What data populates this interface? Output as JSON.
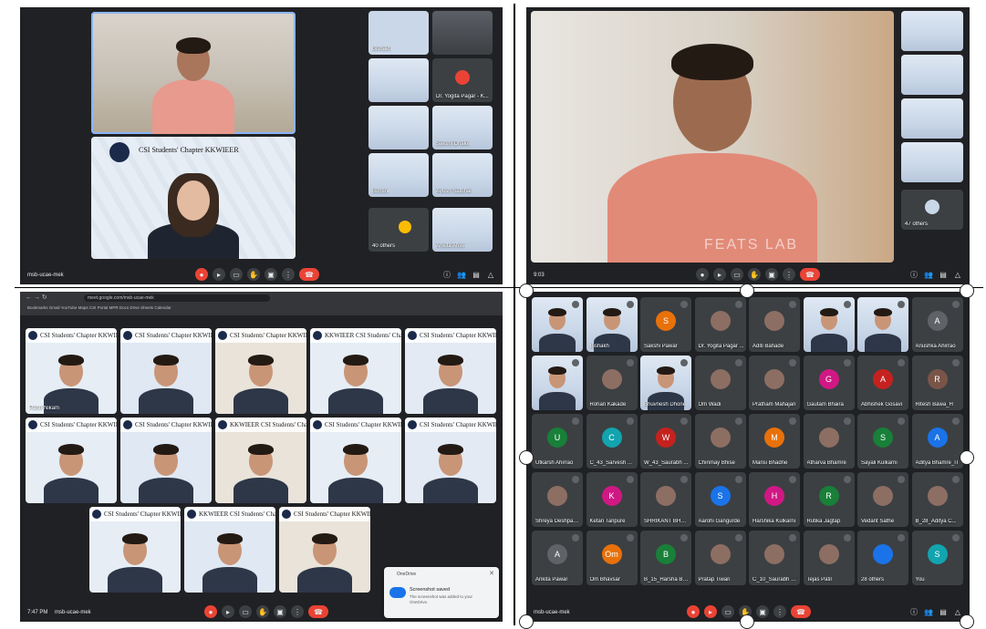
{
  "meeting_label": "meet.google.com",
  "meet_label_short": "msb-ucae-mek",
  "chapter_banner": "CSI Students' Chapter KKWIEER",
  "chapter_banner_alt": "KKWIEER CSI Students' Chapter",
  "times": {
    "p3": "7:47 PM",
    "p2": "9:03"
  },
  "panel1": {
    "others_label": "40 others",
    "side_names": [
      "Bishakh",
      "",
      "Dr. Yogita Pagar - K...",
      "",
      "Sakshi Dhake",
      "",
      "Buhsni",
      "Ayush Satbhai",
      "",
      "Ankita Ahire"
    ]
  },
  "panel2": {
    "others_label": "47 others",
    "presenter_watermark": "FEATS LAB"
  },
  "panel3": {
    "url": "meet.google.com/msb-ucae-mek",
    "bookmarks": "Bookmarks   Gmail   YouTube   Maps   CSI Portal   MPR   Docs   Drive   Sheets   Calendar",
    "row_names": [
      "Parth Nikam",
      "",
      "",
      "",
      "",
      "",
      "",
      "",
      "",
      "",
      "",
      "",
      ""
    ],
    "toast": {
      "app": "OneDrive",
      "title": "Screenshot saved",
      "body": "The screenshot was added to your OneDrive."
    }
  },
  "panel4": {
    "tiles": [
      {
        "name": "",
        "initial": "",
        "color": "",
        "video": true
      },
      {
        "name": "Bishakh",
        "initial": "",
        "color": "",
        "video": true
      },
      {
        "name": "Sakshi Pawar",
        "initial": "S",
        "color": "#e8710a"
      },
      {
        "name": "Dr. Yogita Pagar ...",
        "initial": "",
        "color": "",
        "photo": true
      },
      {
        "name": "Aditi Bahade",
        "initial": "",
        "color": "",
        "photo": true
      },
      {
        "name": "",
        "initial": "",
        "color": "",
        "video": true
      },
      {
        "name": "",
        "initial": "",
        "color": "",
        "video": true
      },
      {
        "name": "Anushka Ahirrao",
        "initial": "A",
        "color": "#5f6368"
      },
      {
        "name": "",
        "initial": "",
        "color": "",
        "video": true
      },
      {
        "name": "Rohan Kakade",
        "initial": "",
        "color": "",
        "photo": true
      },
      {
        "name": "Bhuvnesh Dhone",
        "initial": "",
        "color": "",
        "video": true
      },
      {
        "name": "Om Wadi",
        "initial": "",
        "color": "",
        "photo": true
      },
      {
        "name": "Pratham Mahajan",
        "initial": "",
        "color": "",
        "photo": true
      },
      {
        "name": "Gautam Bhaira",
        "initial": "G",
        "color": "#d01884"
      },
      {
        "name": "Abhishek Gosavi",
        "initial": "A",
        "color": "#c5221f"
      },
      {
        "name": "Ritesh Bawa_H",
        "initial": "R",
        "color": "#795548"
      },
      {
        "name": "Utkarsh Ahirrao",
        "initial": "U",
        "color": "#188038"
      },
      {
        "name": "C_43_Sarvesh ...",
        "initial": "C",
        "color": "#12a4af"
      },
      {
        "name": "W_43_Saurabh ...",
        "initial": "W",
        "color": "#c5221f"
      },
      {
        "name": "Chinmay Bhise",
        "initial": "",
        "color": "",
        "photo": true
      },
      {
        "name": "Mansi Bhadne",
        "initial": "M",
        "color": "#e8710a"
      },
      {
        "name": "Atharva Bhamre",
        "initial": "",
        "color": "",
        "photo": true
      },
      {
        "name": "Sayali Kulkarni",
        "initial": "S",
        "color": "#188038"
      },
      {
        "name": "Aditya Bhamre_IT",
        "initial": "A",
        "color": "#1a73e8"
      },
      {
        "name": "Shreya Deshpande",
        "initial": "",
        "color": "",
        "photo": true
      },
      {
        "name": "Ketan Tanpure",
        "initial": "K",
        "color": "#d01884"
      },
      {
        "name": "SHRIKANT BHOSALE",
        "initial": "",
        "color": "",
        "photo": true
      },
      {
        "name": "Aarohi Gangurde",
        "initial": "S",
        "color": "#1a73e8"
      },
      {
        "name": "Harshika Kulkarni",
        "initial": "H",
        "color": "#d01884"
      },
      {
        "name": "Rutika Jagtap",
        "initial": "R",
        "color": "#188038"
      },
      {
        "name": "Vedant Sathe",
        "initial": "",
        "color": "",
        "photo": true
      },
      {
        "name": "B_28_Aditya C...",
        "initial": "",
        "color": "",
        "photo": true
      },
      {
        "name": "Ankita Pawar",
        "initial": "A",
        "color": "#5f6368"
      },
      {
        "name": "Om Bhavsar",
        "initial": "Om",
        "color": "#e8710a"
      },
      {
        "name": "B_15_Harsha Bh...",
        "initial": "B",
        "color": "#188038"
      },
      {
        "name": "Pratap Tiwari",
        "initial": "",
        "color": "",
        "photo": true
      },
      {
        "name": "C_10_Saurabh Bh...",
        "initial": "",
        "color": "",
        "photo": true
      },
      {
        "name": "Tejas Patil",
        "initial": "",
        "color": "",
        "photo": true
      },
      {
        "name": "28 others",
        "initial": "",
        "color": "",
        "others": true
      },
      {
        "name": "You",
        "initial": "S",
        "color": "#12a4af"
      }
    ]
  },
  "colors": {
    "meet_bg": "#202124",
    "tile_bg": "#3c4043",
    "end_call": "#ea4335",
    "accent": "#8ab4f8"
  }
}
